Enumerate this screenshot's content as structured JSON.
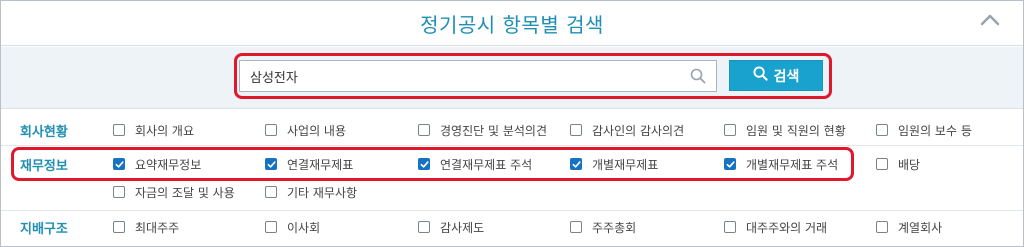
{
  "header": {
    "title": "정기공시 항목별 검색",
    "collapse_icon": "chevron-up-icon"
  },
  "search": {
    "value": "삼성전자",
    "button_label": "검색",
    "icon": "search-icon"
  },
  "colors": {
    "accent": "#1f8fb3",
    "button": "#1aa2cf",
    "highlight": "#e0182c",
    "checked": "#1673c4"
  },
  "sections": [
    {
      "label": "회사현황",
      "options": [
        {
          "label": "회사의 개요",
          "checked": false
        },
        {
          "label": "사업의 내용",
          "checked": false
        },
        {
          "label": "경영진단 및 분석의견",
          "checked": false
        },
        {
          "label": "감사인의 감사의견",
          "checked": false
        },
        {
          "label": "임원 및 직원의 현황",
          "checked": false
        },
        {
          "label": "임원의 보수 등",
          "checked": false
        }
      ]
    },
    {
      "label": "재무정보",
      "options": [
        {
          "label": "요약재무정보",
          "checked": true
        },
        {
          "label": "연결재무제표",
          "checked": true
        },
        {
          "label": "연결재무제표 주석",
          "checked": true
        },
        {
          "label": "개별재무제표",
          "checked": true
        },
        {
          "label": "개별재무제표 주석",
          "checked": true
        },
        {
          "label": "배당",
          "checked": false
        },
        {
          "label": "자금의 조달 및 사용",
          "checked": false
        },
        {
          "label": "기타 재무사항",
          "checked": false
        }
      ]
    },
    {
      "label": "지배구조",
      "options": [
        {
          "label": "최대주주",
          "checked": false
        },
        {
          "label": "이사회",
          "checked": false
        },
        {
          "label": "감사제도",
          "checked": false
        },
        {
          "label": "주주총회",
          "checked": false
        },
        {
          "label": "대주주와의 거래",
          "checked": false
        },
        {
          "label": "계열회사",
          "checked": false
        }
      ]
    }
  ]
}
